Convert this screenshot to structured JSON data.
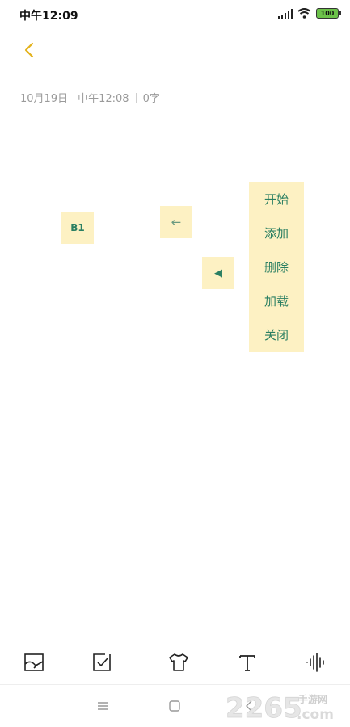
{
  "status_bar": {
    "time": "中午12:09",
    "battery": "100"
  },
  "note": {
    "date": "10月19日",
    "time": "中午12:08",
    "word_count": "0字"
  },
  "floating_buttons": {
    "b1_label": "B1",
    "arrow_label": "←",
    "triangle_label": "◀"
  },
  "menu": {
    "items": [
      {
        "label": "开始"
      },
      {
        "label": "添加"
      },
      {
        "label": "删除"
      },
      {
        "label": "加载"
      },
      {
        "label": "关闭"
      }
    ]
  },
  "toolbar": {
    "tools": [
      "image-icon",
      "checkbox-icon",
      "shirt-icon",
      "text-format-icon",
      "voice-icon"
    ]
  },
  "watermark": {
    "text": "2265",
    "suffix": "手游网",
    "domain": ".com"
  },
  "colors": {
    "accent": "#e3b21b",
    "menu_bg": "#fdf1c3",
    "menu_text": "#2a7f62"
  }
}
